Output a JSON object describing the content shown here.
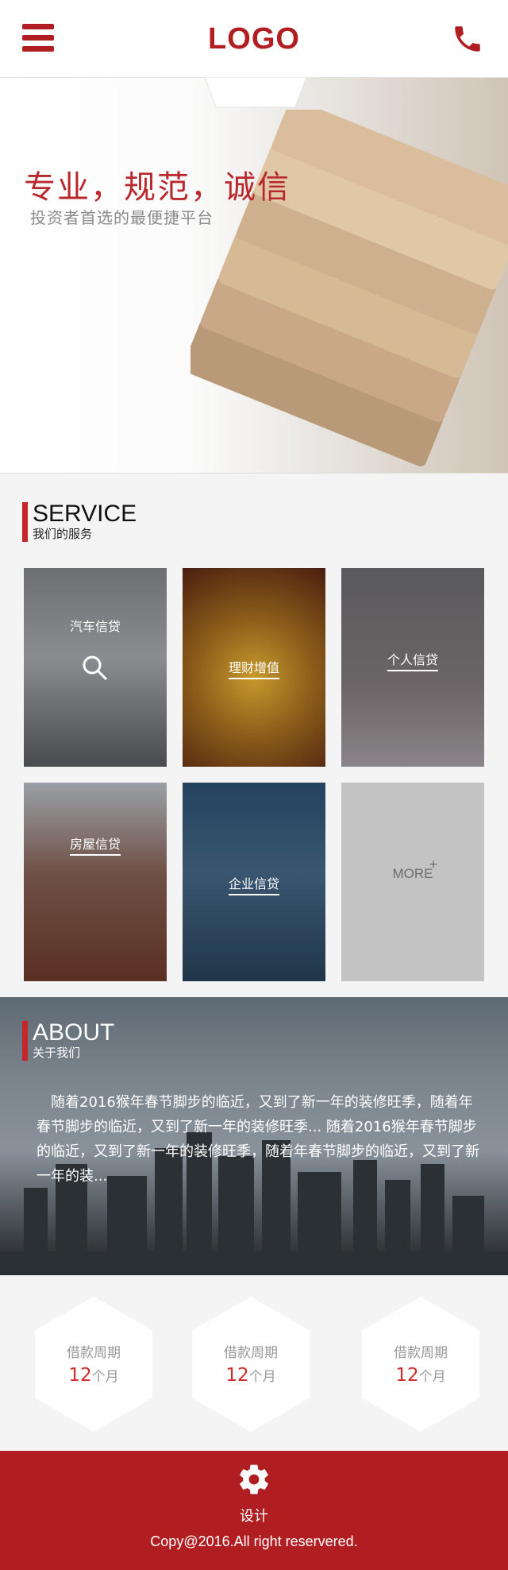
{
  "header": {
    "logo": "LOGO",
    "menu_icon": "menu-icon",
    "phone_icon": "phone-icon",
    "brand_color": "#b01e22"
  },
  "banner": {
    "title": "专业，规范，诚信",
    "subtitle": "投资者首选的最便捷平台"
  },
  "service": {
    "heading_en": "SERVICE",
    "heading_cn": "我们的服务",
    "items": [
      {
        "label": "汽车信贷"
      },
      {
        "label": "理财增值"
      },
      {
        "label": "个人信贷"
      },
      {
        "label": "房屋信贷"
      },
      {
        "label": "企业信贷"
      },
      {
        "label": "MORE"
      }
    ]
  },
  "about": {
    "heading_en": "ABOUT",
    "heading_cn": "关于我们",
    "text": "随着2016猴年春节脚步的临近，又到了新一年的装修旺季，随着年春节脚步的临近，又到了新一年的装修旺季...  随着2016猴年春节脚步的临近，又到了新一年的装修旺季，随着年春节脚步的临近，又到了新一年的装..."
  },
  "stats": [
    {
      "label": "借款周期",
      "value": "12",
      "unit": "个月"
    },
    {
      "label": "借款周期",
      "value": "12",
      "unit": "个月"
    },
    {
      "label": "借款周期",
      "value": "12",
      "unit": "个月"
    }
  ],
  "footer": {
    "icon": "gear-icon",
    "label": "设计",
    "copyright": "Copy@2016.All right reservered."
  }
}
